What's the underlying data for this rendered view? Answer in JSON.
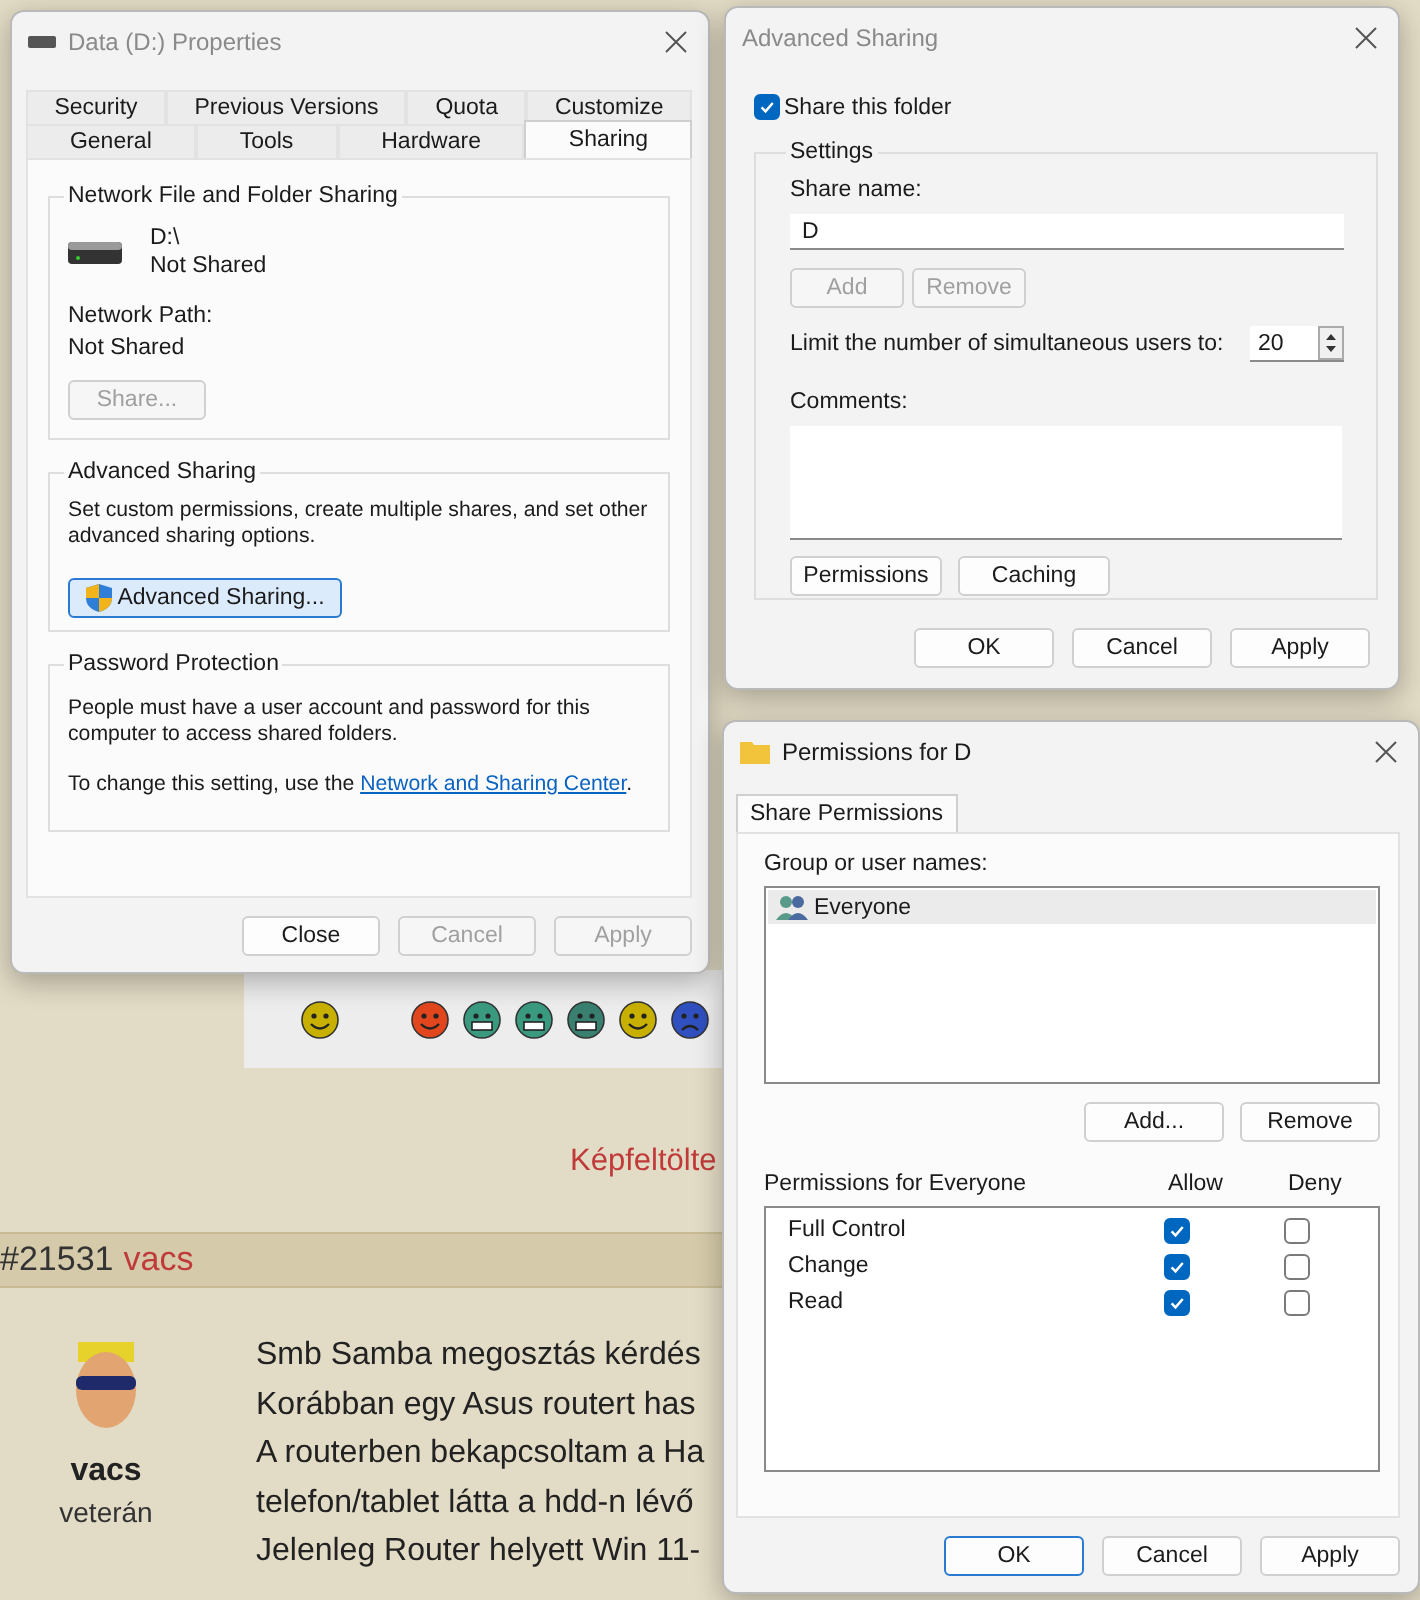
{
  "forum": {
    "image_upload_link": "Képfeltölte",
    "post": {
      "number": "#21531",
      "author": "vacs",
      "user_name": "vacs",
      "rank": "veterán",
      "lines": [
        "Smb Samba megosztás kérdés",
        "Korábban egy Asus routert has",
        "A routerben bekapcsoltam a Ha",
        "telefon/tablet látta a hdd-n lévő",
        "Jelenleg Router helyett Win 11-"
      ]
    }
  },
  "properties": {
    "title": "Data (D:) Properties",
    "active": false,
    "tab_rows": [
      [
        {
          "label": "Security",
          "selected": false
        },
        {
          "label": "Previous Versions",
          "selected": false
        },
        {
          "label": "Quota",
          "selected": false
        },
        {
          "label": "Customize",
          "selected": false
        }
      ],
      [
        {
          "label": "General",
          "selected": false
        },
        {
          "label": "Tools",
          "selected": false
        },
        {
          "label": "Hardware",
          "selected": false
        },
        {
          "label": "Sharing",
          "selected": true
        }
      ]
    ],
    "network_group": {
      "heading": "Network File and Folder Sharing",
      "drive": "D:\\",
      "drive_status": "Not Shared",
      "path_label": "Network Path:",
      "path_value": "Not Shared",
      "share_button": {
        "label": "Share...",
        "disabled": true
      }
    },
    "advanced_group": {
      "heading": "Advanced Sharing",
      "description": "Set custom permissions, create multiple shares, and set other advanced sharing options.",
      "button": {
        "label": "Advanced Sharing...",
        "disabled": false,
        "hovered": true
      }
    },
    "password_group": {
      "heading": "Password Protection",
      "description": "People must have a user account and password for this computer to access shared folders.",
      "change_text": "To change this setting, use the ",
      "link": "Network and Sharing Center",
      "change_suffix": "."
    },
    "buttons": [
      {
        "label": "Close",
        "disabled": false
      },
      {
        "label": "Cancel",
        "disabled": true
      },
      {
        "label": "Apply",
        "disabled": true
      }
    ]
  },
  "advanced_sharing": {
    "title": "Advanced Sharing",
    "active": false,
    "share_checkbox": {
      "label": "Share this folder",
      "checked": true
    },
    "settings": {
      "heading": "Settings",
      "share_name_label": "Share name:",
      "share_name": "D",
      "name_buttons": [
        {
          "label": "Add",
          "disabled": true
        },
        {
          "label": "Remove",
          "disabled": true
        }
      ],
      "limit_label": "Limit the number of simultaneous users to:",
      "limit_value": "20",
      "comments_label": "Comments:",
      "buttons": [
        {
          "label": "Permissions",
          "disabled": false
        },
        {
          "label": "Caching",
          "disabled": false
        }
      ]
    },
    "buttons": [
      {
        "label": "OK",
        "disabled": false
      },
      {
        "label": "Cancel",
        "disabled": false
      },
      {
        "label": "Apply",
        "disabled": false
      }
    ]
  },
  "permissions": {
    "title": "Permissions for D",
    "active": true,
    "tabs": [
      {
        "label": "Share Permissions",
        "selected": true
      }
    ],
    "group_label": "Group or user names:",
    "users": [
      {
        "name": "Everyone",
        "selected": true
      }
    ],
    "user_buttons": [
      {
        "label": "Add...",
        "disabled": false
      },
      {
        "label": "Remove",
        "disabled": false
      }
    ],
    "permissions_label": "Permissions for Everyone",
    "allow_header": "Allow",
    "deny_header": "Deny",
    "rows": [
      {
        "name": "Full Control",
        "allow": true,
        "deny": false
      },
      {
        "name": "Change",
        "allow": true,
        "deny": false
      },
      {
        "name": "Read",
        "allow": true,
        "deny": false
      }
    ],
    "buttons": [
      {
        "label": "OK",
        "disabled": false,
        "default": true
      },
      {
        "label": "Cancel",
        "disabled": false,
        "default": false
      },
      {
        "label": "Apply",
        "disabled": false,
        "default": false
      }
    ]
  }
}
